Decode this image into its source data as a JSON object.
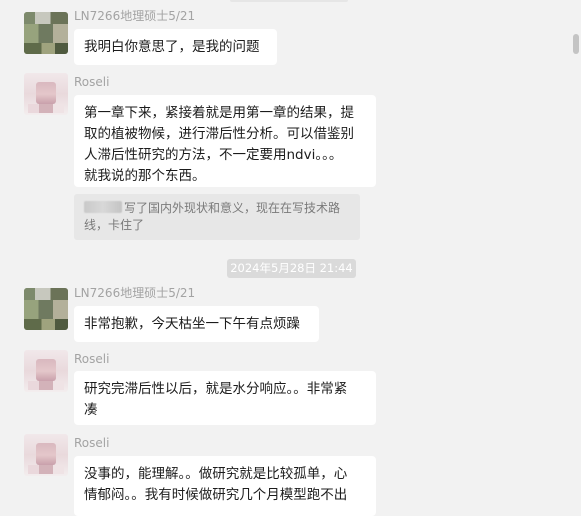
{
  "messages": [
    {
      "sender": "LN7266地理硕士5/21",
      "avatar_icon": "landscape-avatar-icon",
      "lines": [
        "我明白你意思了，是我的问题"
      ]
    },
    {
      "sender": "Roseli",
      "avatar_icon": "person-avatar-icon",
      "lines": [
        "第一章下来，紧接着就是用第一章的结果，提",
        "取的植被物候，进行滞后性分析。可以借鉴别",
        "人滞后性研究的方法，不一定要用ndvi。。。",
        "就我说的那个东西。"
      ],
      "quote_lines": [
        "写了国内外现状和意义，现在在写技术路",
        "线，卡住了"
      ]
    },
    {
      "timestamp": "2024年5月28日 21:44"
    },
    {
      "sender": "LN7266地理硕士5/21",
      "avatar_icon": "landscape-avatar-icon",
      "lines": [
        "非常抱歉，今天枯坐一下午有点烦躁"
      ]
    },
    {
      "sender": "Roseli",
      "avatar_icon": "person-avatar-icon",
      "lines": [
        "研究完滞后性以后，就是水分响应。。非常紧",
        "凑"
      ]
    },
    {
      "sender": "Roseli",
      "avatar_icon": "person-avatar-icon",
      "lines": [
        "没事的，能理解。。做研究就是比较孤单，心",
        "情郁闷。。我有时候做研究几个月模型跑不出"
      ]
    }
  ]
}
